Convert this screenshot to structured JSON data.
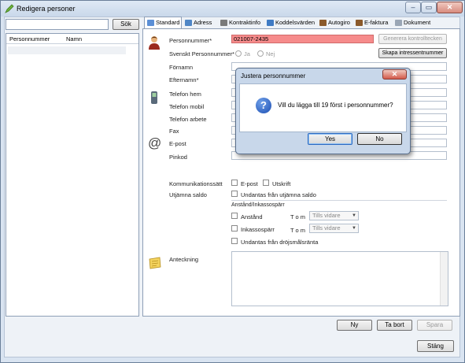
{
  "window": {
    "title": "Redigera personer",
    "min_glyph": "–",
    "max_glyph": "▭",
    "close_glyph": "✕"
  },
  "left": {
    "search_value": "",
    "search_button": "Sök",
    "columns": [
      "Personnummer",
      "Namn"
    ]
  },
  "tabs": [
    {
      "label": "Standard",
      "icon": "standard-icon",
      "color": "#5b8fd6"
    },
    {
      "label": "Adress",
      "icon": "address-icon",
      "color": "#4f86c6"
    },
    {
      "label": "Kontraktinfo",
      "icon": "contract-icon",
      "color": "#7a7a7a"
    },
    {
      "label": "Koddelsvärden",
      "icon": "table-icon",
      "color": "#3f7bc4"
    },
    {
      "label": "Autogiro",
      "icon": "autogiro-icon",
      "color": "#8b5a2b"
    },
    {
      "label": "E-faktura",
      "icon": "efaktura-icon",
      "color": "#8b5a2b"
    },
    {
      "label": "Dokument",
      "icon": "document-icon",
      "color": "#9aa6b5"
    }
  ],
  "form": {
    "personnummer_label": "Personnummer*",
    "personnummer_value": "021007-2435",
    "generera_button": "Generera kontrolltecken",
    "svenskt_label": "Svenskt Personnummer*",
    "ja_label": "Ja",
    "nej_label": "Nej",
    "skapa_button": "Skapa intressentnummer",
    "fornamn_label": "Förnamn",
    "efternamn_label": "Efternamn*",
    "telefon_hem_label": "Telefon hem",
    "telefon_mobil_label": "Telefon mobil",
    "telefon_arbete_label": "Telefon arbete",
    "fax_label": "Fax",
    "epost_label": "E-post",
    "pinkod_label": "Pinkod",
    "kommunikation_label": "Kommunikationssätt",
    "epost_check": "E-post",
    "utskrift_check": "Utskrift",
    "utjamna_label": "Utjämna saldo",
    "undantas_utjamna_check": "Undantas från utjämna saldo",
    "anstand_group": "Anstånd/Inkassospärr",
    "anstand_check": "Anstånd",
    "tom_label_1": "T o m",
    "tills_vidare_1": "Tills vidare",
    "inkasso_check": "Inkassospärr",
    "tom_label_2": "T o m",
    "tills_vidare_2": "Tills vidare",
    "undantas_drojsmal_check": "Undantas från dröjsmålsränta",
    "anteckning_label": "Anteckning"
  },
  "footer": {
    "ny": "Ny",
    "ta_bort": "Ta bort",
    "spara": "Spara",
    "stang": "Stäng"
  },
  "dialog": {
    "title": "Justera personnummer",
    "message": "Vill du lägga till 19 först i personnummer?",
    "yes": "Yes",
    "no": "No",
    "close_glyph": "✕",
    "question_glyph": "?"
  },
  "colors": {
    "error_field": "#f68b8b",
    "dialog_frame": "#c8d7ea",
    "window_frame": "#d9e4f1"
  }
}
